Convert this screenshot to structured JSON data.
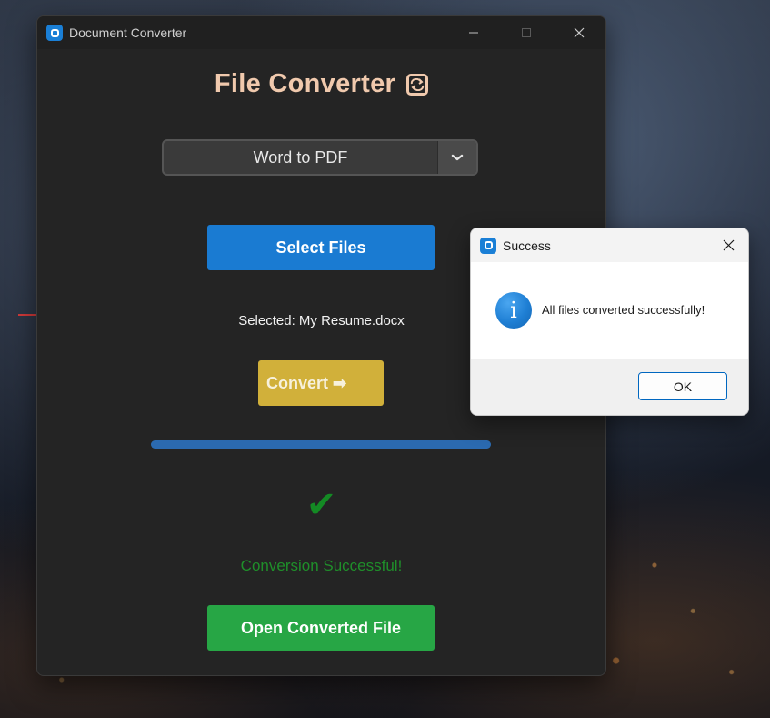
{
  "main_window": {
    "title": "Document Converter",
    "controls": {
      "minimize_icon": "minimize-icon",
      "maximize_icon": "maximize-icon",
      "close_icon": "close-icon"
    },
    "heading": "File Converter",
    "heading_icon": "convert-cycle-icon",
    "dropdown": {
      "selected": "Word to PDF",
      "icon": "chevron-down-icon"
    },
    "select_files_label": "Select Files",
    "selected_text": "Selected: My Resume.docx",
    "convert_label": "Convert ➡",
    "progress": 1.0,
    "success_icon": "✔",
    "status_text": "Conversion Successful!",
    "open_label": "Open Converted File"
  },
  "dialog": {
    "title": "Success",
    "message": "All files converted successfully!",
    "info_glyph": "i",
    "ok_label": "OK"
  },
  "colors": {
    "accent_blue": "#1a7bd2",
    "convert_yellow": "#d1b03a",
    "success_green": "#27a645",
    "heading_peach": "#f0c9ad"
  }
}
